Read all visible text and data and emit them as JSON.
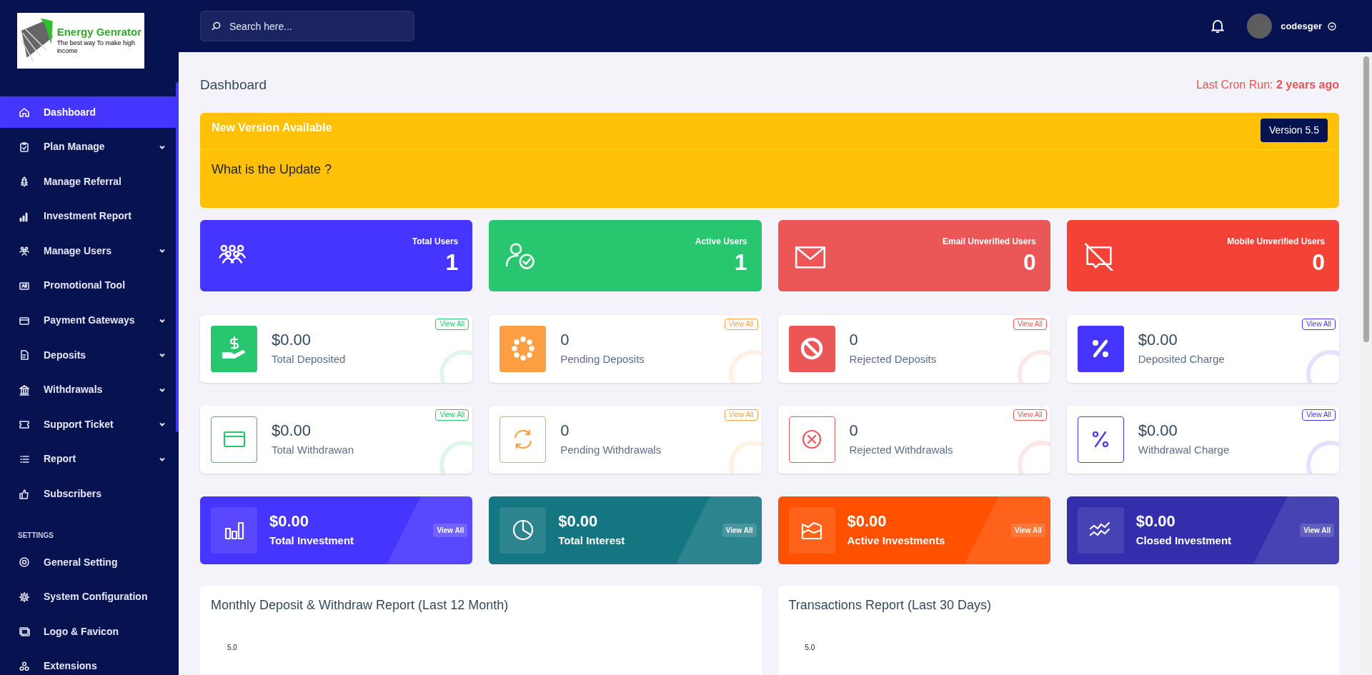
{
  "sidebar": {
    "logo": {
      "title": "Energy Genrator",
      "tagline": "The best way To make high income"
    },
    "items": [
      {
        "label": "Dashboard",
        "has_submenu": false,
        "selected": true
      },
      {
        "label": "Plan Manage",
        "has_submenu": true,
        "selected": false
      },
      {
        "label": "Manage Referral",
        "has_submenu": false,
        "selected": false
      },
      {
        "label": "Investment Report",
        "has_submenu": false,
        "selected": false
      },
      {
        "label": "Manage Users",
        "has_submenu": true,
        "selected": false
      },
      {
        "label": "Promotional Tool",
        "has_submenu": false,
        "selected": false
      },
      {
        "label": "Payment Gateways",
        "has_submenu": true,
        "selected": false
      },
      {
        "label": "Deposits",
        "has_submenu": true,
        "selected": false
      },
      {
        "label": "Withdrawals",
        "has_submenu": true,
        "selected": false
      },
      {
        "label": "Support Ticket",
        "has_submenu": true,
        "selected": false
      },
      {
        "label": "Report",
        "has_submenu": true,
        "selected": false
      },
      {
        "label": "Subscribers",
        "has_submenu": false,
        "selected": false
      }
    ],
    "settings_heading": "SETTINGS",
    "settings_items": [
      {
        "label": "General Setting",
        "selected": false
      },
      {
        "label": "System Configuration",
        "selected": false
      },
      {
        "label": "Logo & Favicon",
        "selected": false
      },
      {
        "label": "Extensions",
        "selected": false
      }
    ]
  },
  "header": {
    "search": {
      "placeholder": "Search here..."
    },
    "user": {
      "name": "codesger"
    }
  },
  "page_title": "Dashboard",
  "cron": "Last Cron Run: **2 years ago**",
  "banner": {
    "title": "New Version Available",
    "version": "Version 5.5",
    "question": "What is the Update ?"
  },
  "stat_cards": [
    {
      "label": "Total Users",
      "value": "1",
      "color": "#4634ff"
    },
    {
      "label": "Active Users",
      "value": "1",
      "color": "#28c76f"
    },
    {
      "label": "Email Unverified Users",
      "value": "0",
      "color": "#eb5757"
    },
    {
      "label": "Mobile Unverified Users",
      "value": "0",
      "color": "#f44336"
    }
  ],
  "widgets": [
    {
      "kind": "solid",
      "value": "$0.00",
      "label": "Total Deposited",
      "link": "View All",
      "color": "#28c76f"
    },
    {
      "kind": "solid",
      "value": "0",
      "label": "Pending Deposits",
      "link": "View All",
      "color": "#ff9f43"
    },
    {
      "kind": "solid",
      "value": "0",
      "label": "Rejected Deposits",
      "link": "View All",
      "color": "#eb5757"
    },
    {
      "kind": "solid",
      "value": "$0.00",
      "label": "Deposited Charge",
      "link": "View All",
      "color": "#4634ff"
    },
    {
      "kind": "outline",
      "value": "$0.00",
      "label": "Total Withdrawan",
      "link": "View All",
      "color": "#28c76f"
    },
    {
      "kind": "outline",
      "value": "0",
      "label": "Pending Withdrawals",
      "link": "View All",
      "color": "#ff9f43"
    },
    {
      "kind": "outline",
      "value": "0",
      "label": "Rejected Withdrawals",
      "link": "View All",
      "color": "#eb5757"
    },
    {
      "kind": "outline",
      "value": "$0.00",
      "label": "Withdrawal Charge",
      "link": "View All",
      "color": "#4634ff"
    }
  ],
  "invest_cards": [
    {
      "value": "$0.00",
      "label": "Total Investment",
      "link": "View All",
      "color": "#4634ff"
    },
    {
      "value": "$0.00",
      "label": "Total Interest",
      "link": "View All",
      "color": "#137681"
    },
    {
      "value": "$0.00",
      "label": "Active Investments",
      "link": "View All",
      "color": "#ff5100"
    },
    {
      "value": "$0.00",
      "label": "Closed Investment",
      "link": "View All",
      "color": "#342ead"
    }
  ],
  "reports": [
    {
      "title": "Monthly Deposit & Withdraw Report (Last 12 Month)",
      "top_tick": "5.0"
    },
    {
      "title": "Transactions Report (Last 30 Days)",
      "top_tick": "5.0"
    }
  ]
}
